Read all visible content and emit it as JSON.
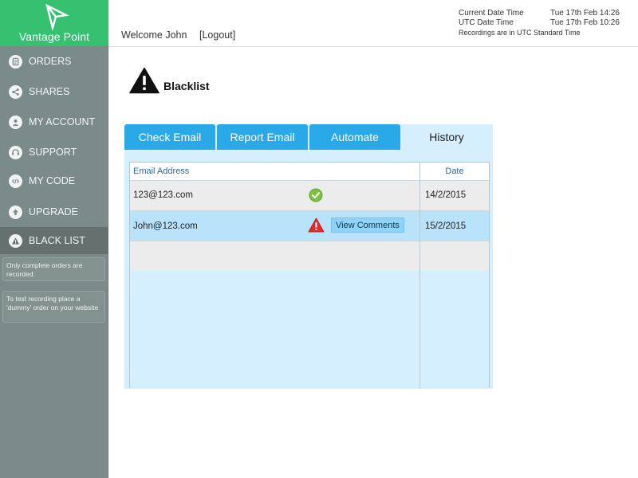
{
  "app": {
    "name": "Vantage Point"
  },
  "header": {
    "welcome": "Welcome John",
    "logout": "[Logout]",
    "current_date_label": "Current Date Time",
    "current_date_value": "Tue 17th Feb 14:26",
    "utc_date_label": "UTC Date Time",
    "utc_date_value": "Tue 17th Feb 10:26",
    "note": "Recordings are in UTC Standard Time"
  },
  "sidebar": {
    "items": [
      {
        "label": "ORDERS",
        "icon": "orders-icon"
      },
      {
        "label": "SHARES",
        "icon": "share-icon"
      },
      {
        "label": "MY ACCOUNT",
        "icon": "user-icon"
      },
      {
        "label": "SUPPORT",
        "icon": "support-icon"
      },
      {
        "label": "MY CODE",
        "icon": "code-icon"
      },
      {
        "label": "UPGRADE",
        "icon": "upgrade-arrow-icon"
      },
      {
        "label": "BLACK LIST",
        "icon": "warning-icon",
        "active": true
      }
    ],
    "notes": [
      "Only complete orders are recorded.",
      "To test recording place a 'dummy' order on your website"
    ]
  },
  "page": {
    "title": "Blacklist",
    "title_icon": "warning-icon"
  },
  "tabs": [
    {
      "label": "Check Email"
    },
    {
      "label": "Report Email"
    },
    {
      "label": "Automate"
    },
    {
      "label": "History",
      "active": true
    }
  ],
  "table": {
    "headers": {
      "email": "Email Address",
      "date": "Date"
    },
    "rows": [
      {
        "email": "123@123.com",
        "status": "ok-check-icon",
        "date": "14/2/2015"
      },
      {
        "email": "John@123.com",
        "status": "warning-icon",
        "action": "View Comments",
        "date": "15/2/2015"
      }
    ]
  },
  "colors": {
    "brand_green": "#35c16f",
    "sidebar": "#7b8b89",
    "tab_blue": "#2aa9e9",
    "panel_light_blue": "#d6efff",
    "warning_red": "#e02b2b",
    "ok_green": "#7cc242"
  }
}
